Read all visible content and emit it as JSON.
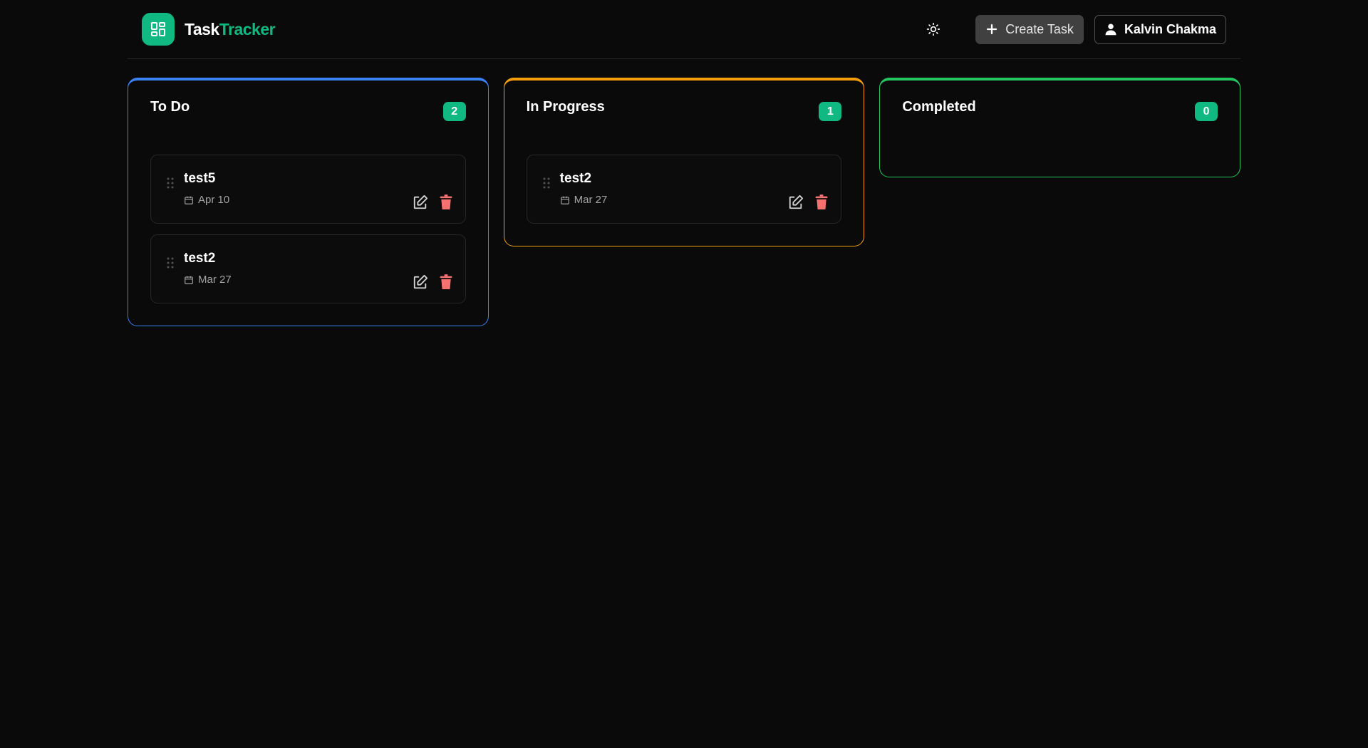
{
  "brand": {
    "name_part1": "Task",
    "name_part2": "Tracker",
    "accent_color": "#10b981"
  },
  "header": {
    "theme_icon": "sun-icon",
    "create_label": "Create Task",
    "user_name": "Kalvin Chakma"
  },
  "columns": [
    {
      "title": "To Do",
      "count": "2",
      "color": "#3b82f6",
      "tasks": [
        {
          "title": "test5",
          "date": "Apr 10"
        },
        {
          "title": "test2",
          "date": "Mar 27"
        }
      ]
    },
    {
      "title": "In Progress",
      "count": "1",
      "color": "#f59e0b",
      "tasks": [
        {
          "title": "test2",
          "date": "Mar 27"
        }
      ]
    },
    {
      "title": "Completed",
      "count": "0",
      "color": "#22c55e",
      "tasks": []
    }
  ]
}
